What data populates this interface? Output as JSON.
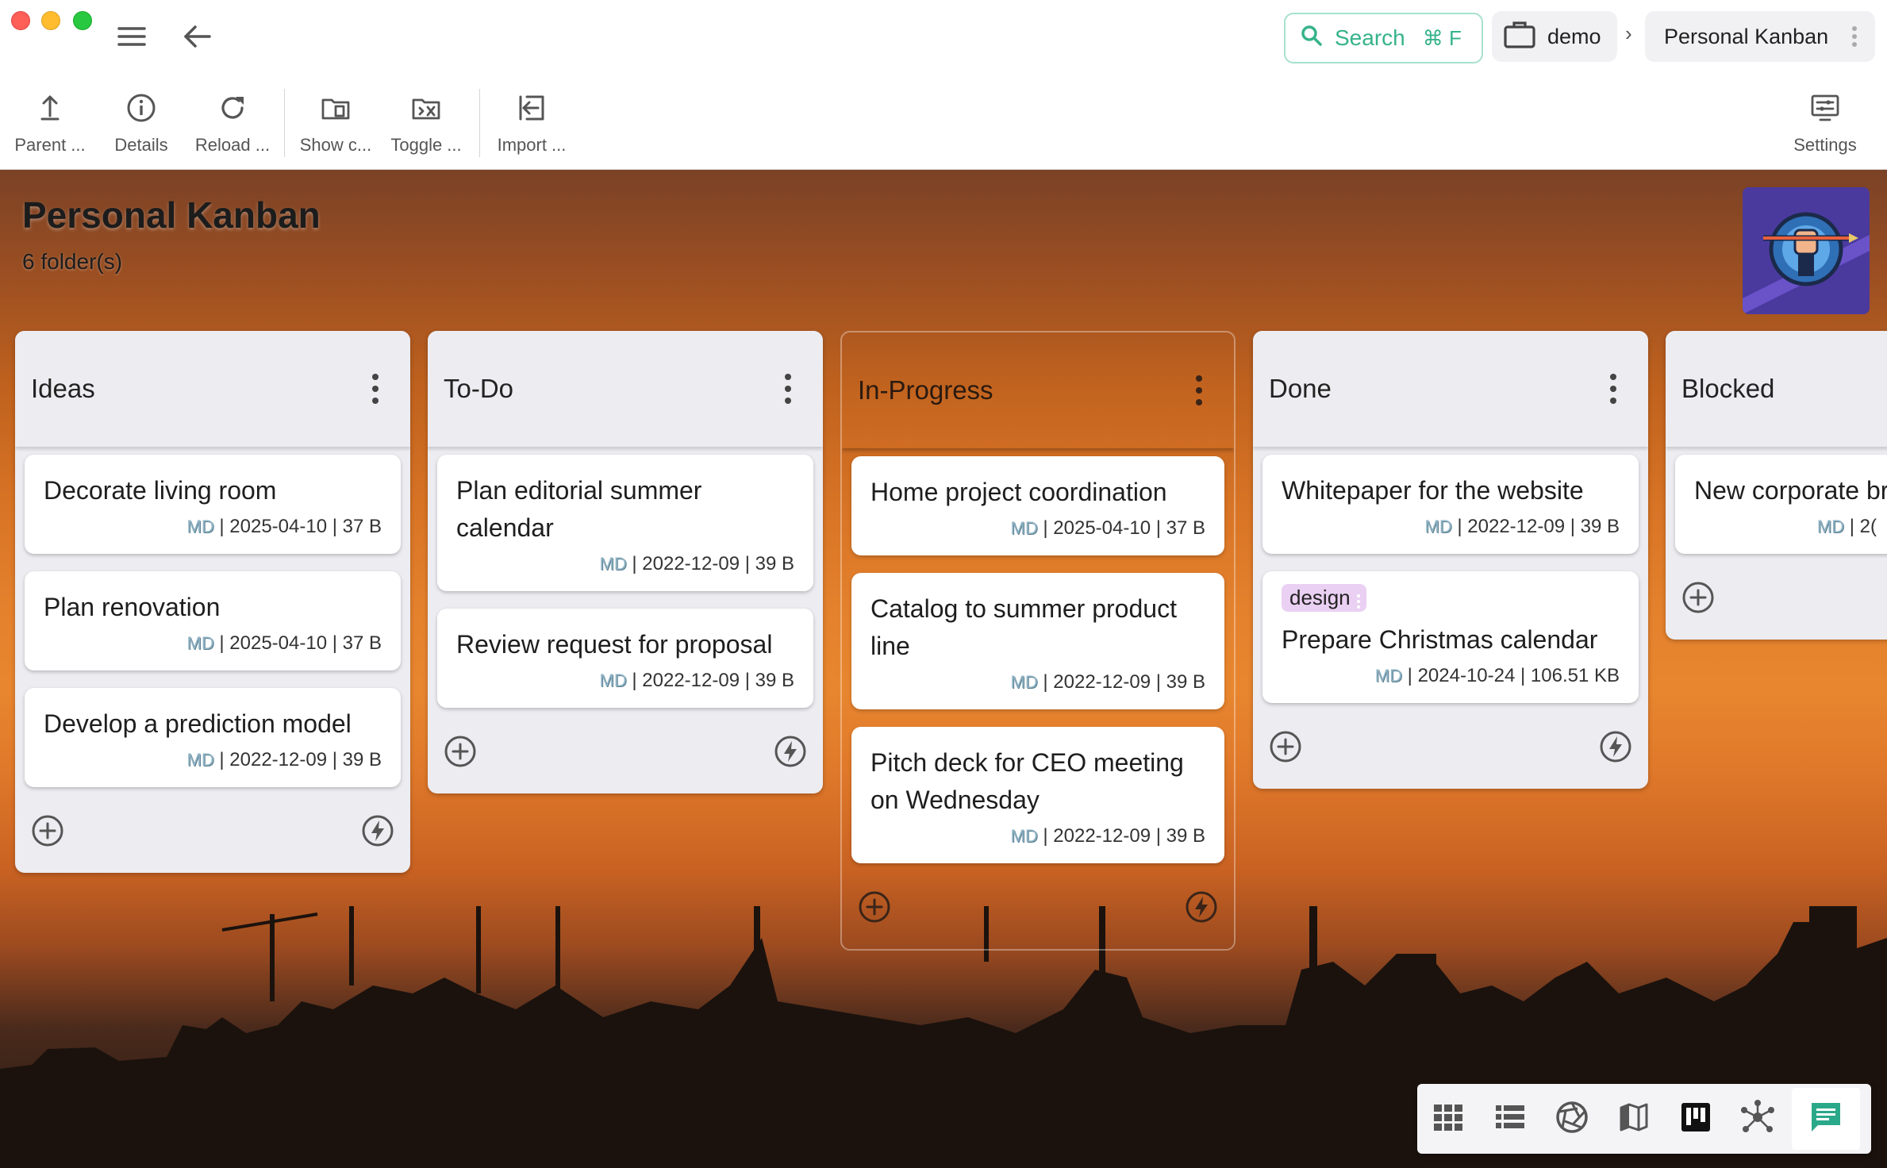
{
  "window": {
    "search_label": "Search",
    "search_shortcut": "⌘ F",
    "workspace": "demo",
    "breadcrumb_separator": "›",
    "current_folder": "Personal Kanban"
  },
  "toolbar": {
    "parent": "Parent ...",
    "details": "Details",
    "reload": "Reload ...",
    "show": "Show c...",
    "toggle": "Toggle ...",
    "import": "Import ...",
    "settings": "Settings"
  },
  "page": {
    "title": "Personal Kanban",
    "subtitle": "6 folder(s)"
  },
  "columns": [
    {
      "name": "Ideas",
      "cards": [
        {
          "title": "Decorate living room",
          "type": "MD",
          "meta": " | 2025-04-10 | 37 B"
        },
        {
          "title": "Plan renovation",
          "type": "MD",
          "meta": " | 2025-04-10 | 37 B"
        },
        {
          "title": "Develop a prediction model",
          "type": "MD",
          "meta": " | 2022-12-09 | 39 B"
        }
      ]
    },
    {
      "name": "To-Do",
      "cards": [
        {
          "title": "Plan editorial summer calendar",
          "type": "MD",
          "meta": " | 2022-12-09 | 39 B"
        },
        {
          "title": "Review request for proposal",
          "type": "MD",
          "meta": " | 2022-12-09 | 39 B"
        }
      ]
    },
    {
      "name": "In-Progress",
      "cards": [
        {
          "title": "Home project coordination",
          "type": "MD",
          "meta": " | 2025-04-10 | 37 B"
        },
        {
          "title": "Catalog to summer product line",
          "type": "MD",
          "meta": " | 2022-12-09 | 39 B"
        },
        {
          "title": "Pitch deck for CEO meeting on Wednesday",
          "type": "MD",
          "meta": " | 2022-12-09 | 39 B"
        }
      ]
    },
    {
      "name": "Done",
      "cards": [
        {
          "title": "Whitepaper for the website",
          "type": "MD",
          "meta": " | 2022-12-09 | 39 B"
        },
        {
          "tag": "design",
          "title": "Prepare Christmas calendar",
          "type": "MD",
          "meta": " | 2024-10-24 | 106.51 KB"
        }
      ]
    },
    {
      "name": "Blocked",
      "cards": [
        {
          "title": "New corporate br",
          "type": "MD",
          "meta": " | 2("
        }
      ]
    }
  ],
  "view_switcher": [
    "grid-view-icon",
    "list-view-icon",
    "gallery-view-icon",
    "map-view-icon",
    "kanban-view-icon",
    "graph-view-icon",
    "chat-icon"
  ],
  "colors": {
    "accent": "#36b38b",
    "tag_design": "#ead0f2",
    "avatar_bg": "#4b3a9e"
  }
}
